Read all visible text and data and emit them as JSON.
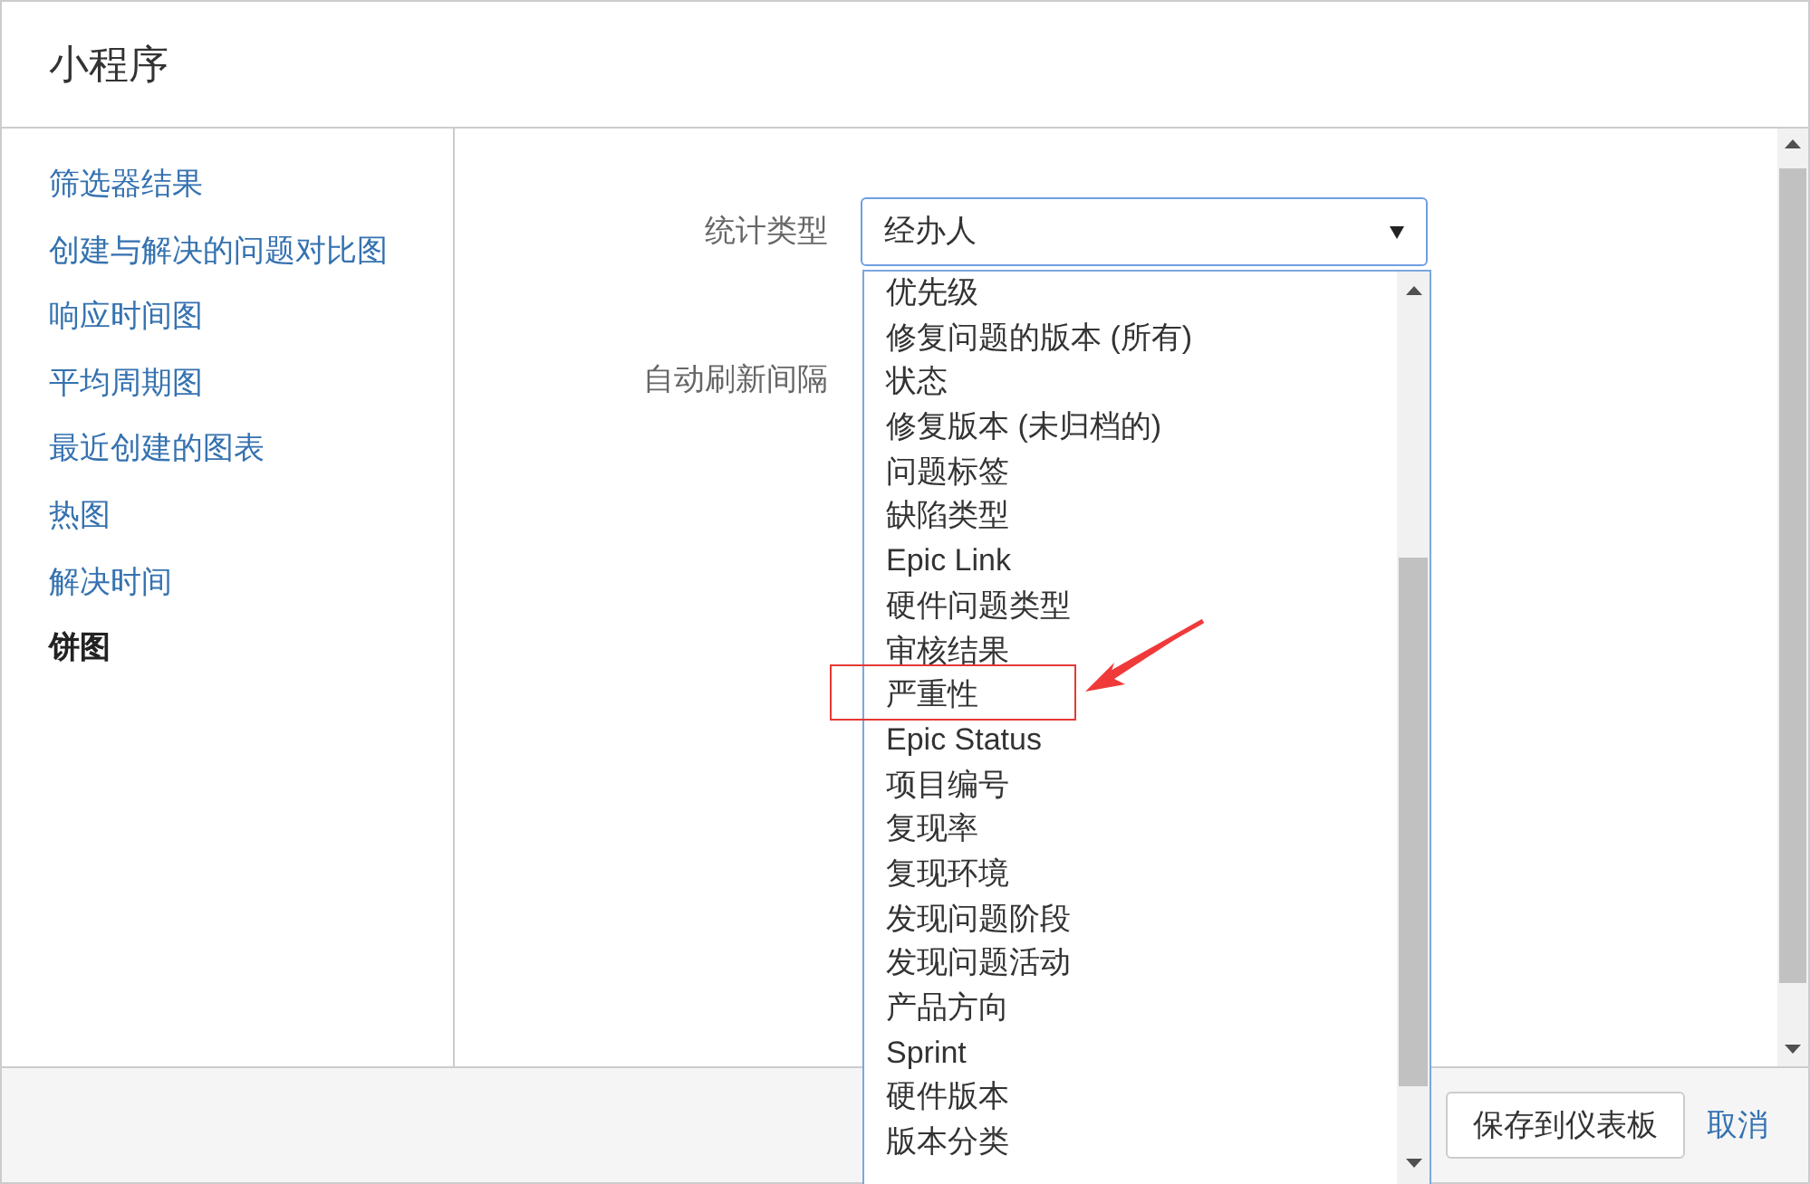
{
  "dialog": {
    "title": "小程序"
  },
  "sidebar": {
    "items": [
      {
        "label": "筛选器结果",
        "selected": false
      },
      {
        "label": "创建与解决的问题对比图",
        "selected": false
      },
      {
        "label": "响应时间图",
        "selected": false
      },
      {
        "label": "平均周期图",
        "selected": false
      },
      {
        "label": "最近创建的图表",
        "selected": false
      },
      {
        "label": "热图",
        "selected": false
      },
      {
        "label": "解决时间",
        "selected": false
      },
      {
        "label": "饼图",
        "selected": true
      }
    ]
  },
  "form": {
    "fields": [
      {
        "label": "统计类型",
        "value": "经办人"
      },
      {
        "label": "自动刷新间隔"
      }
    ]
  },
  "dropdown": {
    "options": [
      {
        "label": "优先级",
        "highlighted": false
      },
      {
        "label": "修复问题的版本 (所有)",
        "highlighted": false
      },
      {
        "label": "状态",
        "highlighted": false
      },
      {
        "label": "修复版本 (未归档的)",
        "highlighted": false
      },
      {
        "label": "问题标签",
        "highlighted": false
      },
      {
        "label": "缺陷类型",
        "highlighted": false
      },
      {
        "label": "Epic Link",
        "highlighted": false
      },
      {
        "label": "硬件问题类型",
        "highlighted": false
      },
      {
        "label": "审核结果",
        "highlighted": false
      },
      {
        "label": "严重性",
        "highlighted": true
      },
      {
        "label": "Epic Status",
        "highlighted": false
      },
      {
        "label": "项目编号",
        "highlighted": false
      },
      {
        "label": "复现率",
        "highlighted": false
      },
      {
        "label": "复现环境",
        "highlighted": false
      },
      {
        "label": "发现问题阶段",
        "highlighted": false
      },
      {
        "label": "发现问题活动",
        "highlighted": false
      },
      {
        "label": "产品方向",
        "highlighted": false
      },
      {
        "label": "Sprint",
        "highlighted": false
      },
      {
        "label": "硬件版本",
        "highlighted": false
      },
      {
        "label": "版本分类",
        "highlighted": false
      }
    ]
  },
  "footer": {
    "buttons": [
      {
        "label": "保存到仪表板",
        "kind": "button"
      },
      {
        "label": "取消",
        "kind": "link"
      }
    ]
  }
}
